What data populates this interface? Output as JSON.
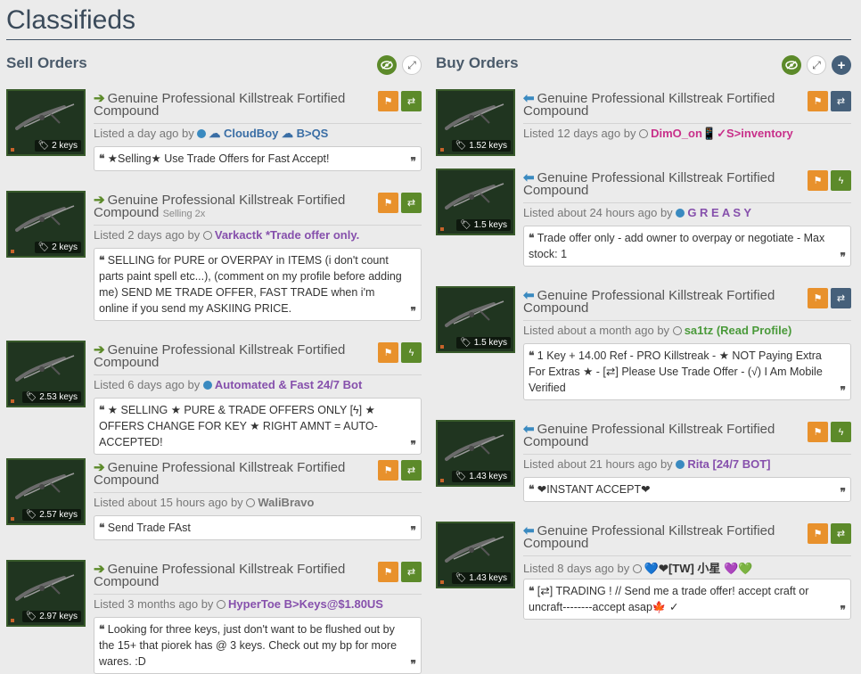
{
  "page": {
    "title": "Classifieds"
  },
  "colors": {
    "sell_arrow": "#5c8a2a",
    "buy_arrow": "#3a8ac0",
    "online_dot": "#3a8ac0",
    "flag_button": "#e8912c",
    "trade_button": "#5c8a2a",
    "offer_button": "#46607a"
  },
  "sell": {
    "title": "Sell Orders",
    "listings": [
      {
        "item": "Genuine Professional Killstreak Fortified Compound",
        "quantity": "",
        "price": "2 keys",
        "time": "Listed a day ago by",
        "user": "☁ CloudBoy ☁ B>QS",
        "user_color": "#3a6ea5",
        "online": true,
        "action_icon": "swap-icon",
        "comment": "★Selling★ Use Trade Offers for Fast Accept!"
      },
      {
        "item": "Genuine Professional Killstreak Fortified Compound",
        "quantity": "Selling 2x",
        "price": "2 keys",
        "time": "Listed 2 days ago by",
        "user": "Varkactk *Trade offer only.",
        "user_color": "#8650ac",
        "online": false,
        "action_icon": "swap-icon",
        "comment": "SELLING for PURE or OVERPAY in ITEMS (i don't count parts paint spell etc...), (comment on my profile before adding me) SEND ME TRADE OFFER, FAST TRADE when i'm online if you send my ASKIING PRICE."
      },
      {
        "item": "Genuine Professional Killstreak Fortified Compound",
        "quantity": "",
        "price": "2.53 keys",
        "time": "Listed 6 days ago by",
        "user": "Automated & Fast 24/7 Bot",
        "user_color": "#8650ac",
        "online": true,
        "action_icon": "bolt-icon",
        "comment": "★ SELLING ★ PURE & TRADE OFFERS ONLY [ϟ] ★ OFFERS CHANGE FOR KEY ★ RIGHT AMNT = AUTO-ACCEPTED!"
      },
      {
        "item": "Genuine Professional Killstreak Fortified Compound",
        "quantity": "",
        "price": "2.57 keys",
        "time": "Listed about 15 hours ago by",
        "user": "WaliBravo",
        "user_color": "#777777",
        "online": false,
        "action_icon": "swap-icon",
        "comment": "Send Trade FAst"
      },
      {
        "item": "Genuine Professional Killstreak Fortified Compound",
        "quantity": "",
        "price": "2.97 keys",
        "time": "Listed 3 months ago by",
        "user": "HyperToe B>Keys@$1.80US",
        "user_color": "#8650ac",
        "online": false,
        "action_icon": "swap-icon",
        "comment": "Looking for three keys, just don't want to be flushed out by the 15+ that piorek has @ 3 keys. Check out my bp for more wares. :D"
      }
    ]
  },
  "buy": {
    "title": "Buy Orders",
    "listings": [
      {
        "item": "Genuine Professional Killstreak Fortified Compound",
        "price": "1.52 keys",
        "time": "Listed 12 days ago by",
        "user": "DimO_on📱✓S>inventory",
        "user_color": "#c8308a",
        "online": false,
        "action_icon": "swap-icon",
        "comment": ""
      },
      {
        "item": "Genuine Professional Killstreak Fortified Compound",
        "price": "1.5 keys",
        "time": "Listed about 24 hours ago by",
        "user": "G R E A S Y",
        "user_color": "#8650ac",
        "online": true,
        "action_icon": "bolt-icon",
        "comment": "Trade offer only - add owner to overpay or negotiate - Max stock: 1"
      },
      {
        "item": "Genuine Professional Killstreak Fortified Compound",
        "price": "1.5 keys",
        "time": "Listed about a month ago by",
        "user": "sa1tz (Read Profile)",
        "user_color": "#4a9a3a",
        "online": false,
        "action_icon": "swap-icon",
        "comment": "1 Key + 14.00 Ref - PRO Killstreak - ★ NOT Paying Extra For Extras ★ - [⇄] Please Use Trade Offer - (√) I Am Mobile Verified"
      },
      {
        "item": "Genuine Professional Killstreak Fortified Compound",
        "price": "1.43 keys",
        "time": "Listed about 21 hours ago by",
        "user": "Rita [24/7 BOT]",
        "user_color": "#8650ac",
        "online": true,
        "action_icon": "bolt-icon",
        "comment": "❤INSTANT ACCEPT❤"
      },
      {
        "item": "Genuine Professional Killstreak Fortified Compound",
        "price": "1.43 keys",
        "time": "Listed 8 days ago by",
        "user": "💙❤[TW] 小星 💜💚",
        "user_color": "#333333",
        "online": false,
        "action_icon": "swap-icon",
        "comment": "[⇄] TRADING ! // Send me a trade offer! accept craft or uncraft--------accept asap🍁 ✓"
      }
    ]
  }
}
